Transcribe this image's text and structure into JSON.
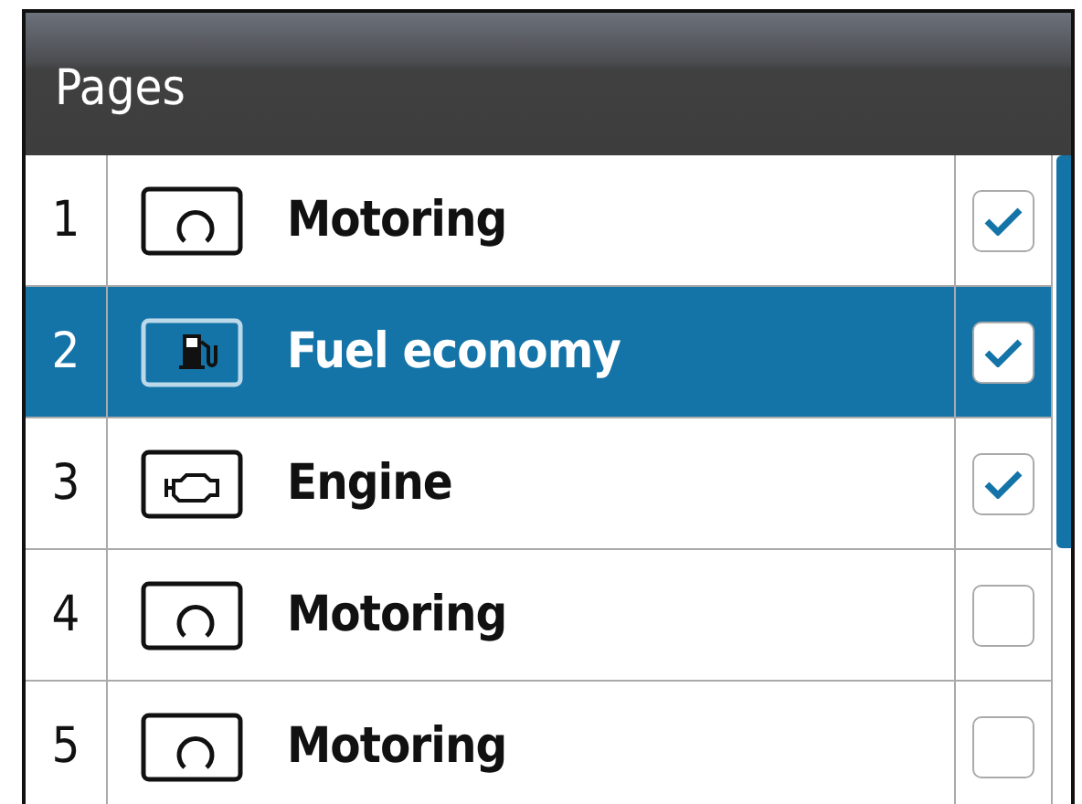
{
  "header": {
    "title": "Pages"
  },
  "pages": [
    {
      "number": "1",
      "kind": "gauge",
      "label": "Motoring",
      "checked": true,
      "selected": false
    },
    {
      "number": "2",
      "kind": "fuel",
      "label": "Fuel economy",
      "checked": true,
      "selected": true
    },
    {
      "number": "3",
      "kind": "engine",
      "label": "Engine",
      "checked": true,
      "selected": false
    },
    {
      "number": "4",
      "kind": "gauge",
      "label": "Motoring",
      "checked": false,
      "selected": false
    },
    {
      "number": "5",
      "kind": "gauge",
      "label": "Motoring",
      "checked": false,
      "selected": false
    }
  ]
}
